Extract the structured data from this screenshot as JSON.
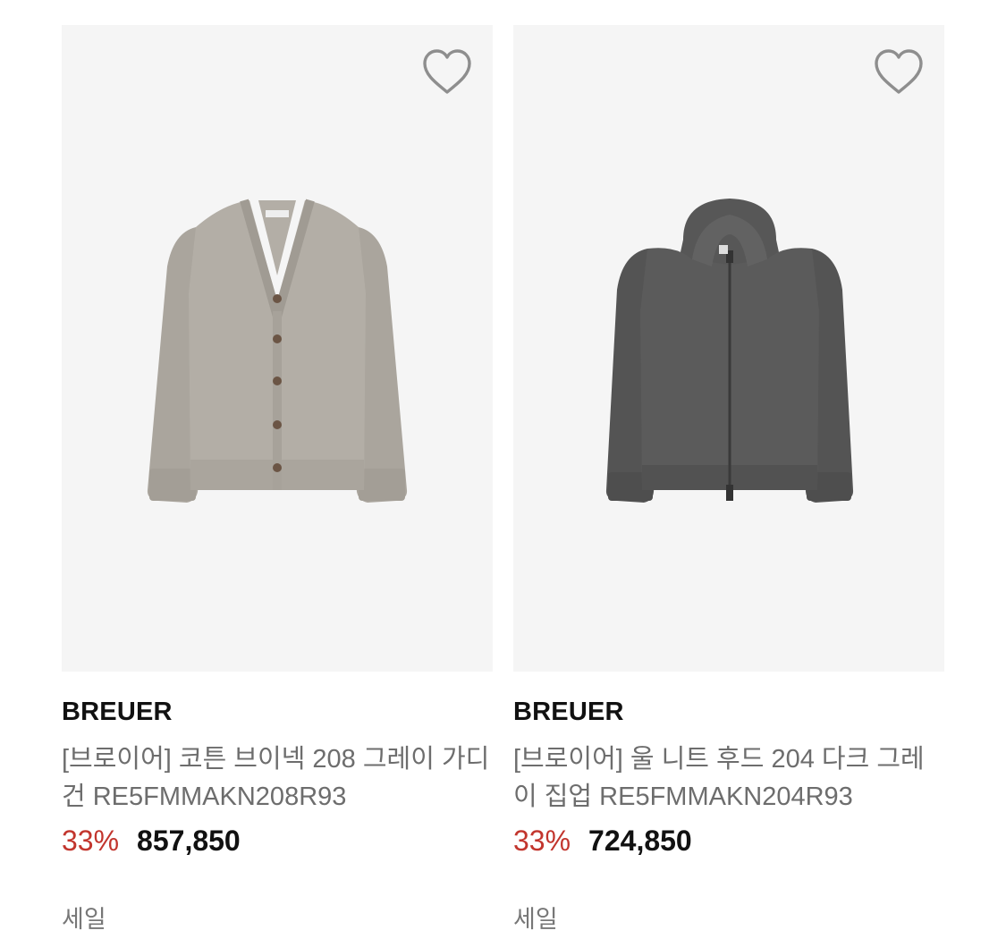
{
  "colors": {
    "thumb_bg": "#f5f5f5",
    "discount": "#c2352d",
    "brand_text": "#111111",
    "title_text": "#6d6d6d",
    "light_gray_knit": "#b3aea6",
    "dark_gray_knit": "#5b5b5b"
  },
  "products": [
    {
      "brand": "BREUER",
      "title": "[브로이어] 코튼 브이넥 208 그레이 가디건 RE5FMMAKN208R93",
      "discount": "33%",
      "price": "857,850",
      "tag": "세일",
      "wishlist_icon": "heart-outline-icon",
      "image": "light-gray-v-neck-cardigan"
    },
    {
      "brand": "BREUER",
      "title": "[브로이어] 울 니트 후드 204 다크 그레이 집업 RE5FMMAKN204R93",
      "discount": "33%",
      "price": "724,850",
      "tag": "세일",
      "wishlist_icon": "heart-outline-icon",
      "image": "dark-gray-hooded-zip-up"
    }
  ]
}
